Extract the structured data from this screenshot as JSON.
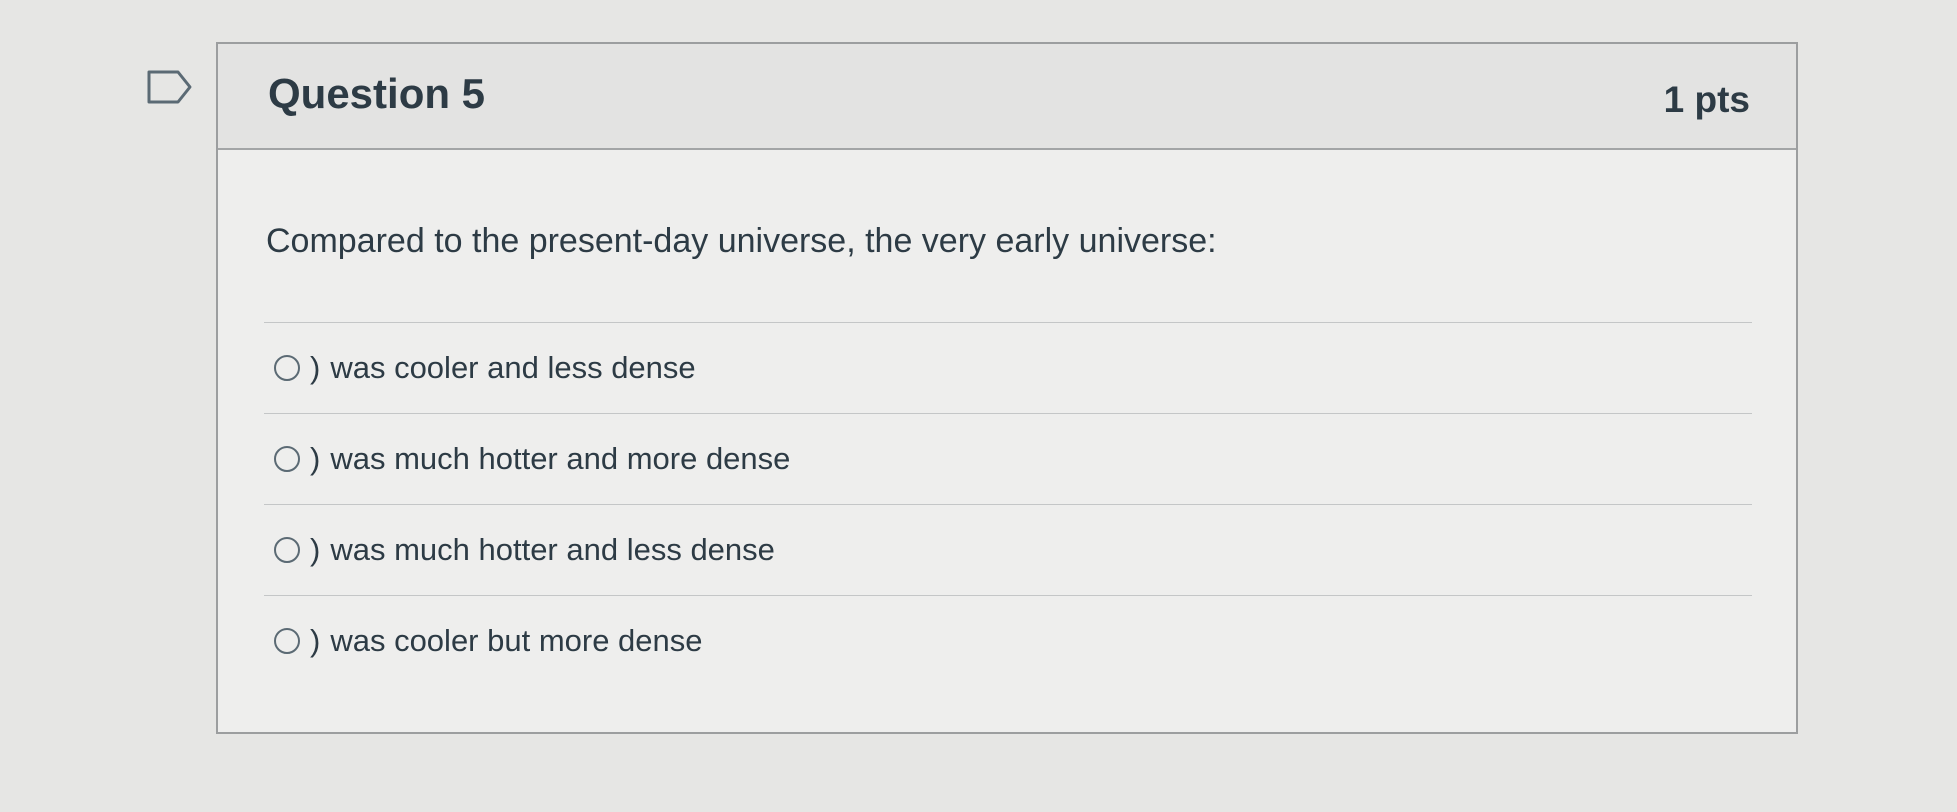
{
  "question": {
    "title": "Question 5",
    "points": "1 pts",
    "text": "Compared to the present-day universe, the very early universe:",
    "flag_icon": "bookmark-flag-icon"
  },
  "answers": [
    {
      "marker": ")",
      "label": "was cooler and less dense"
    },
    {
      "marker": ")",
      "label": "was much hotter and more dense"
    },
    {
      "marker": ")",
      "label": "was much hotter and less dense"
    },
    {
      "marker": ")",
      "label": "was cooler but more dense"
    }
  ],
  "colors": {
    "text": "#2d3b45",
    "border": "#9c9e9f",
    "header_bg": "#e3e3e2"
  }
}
